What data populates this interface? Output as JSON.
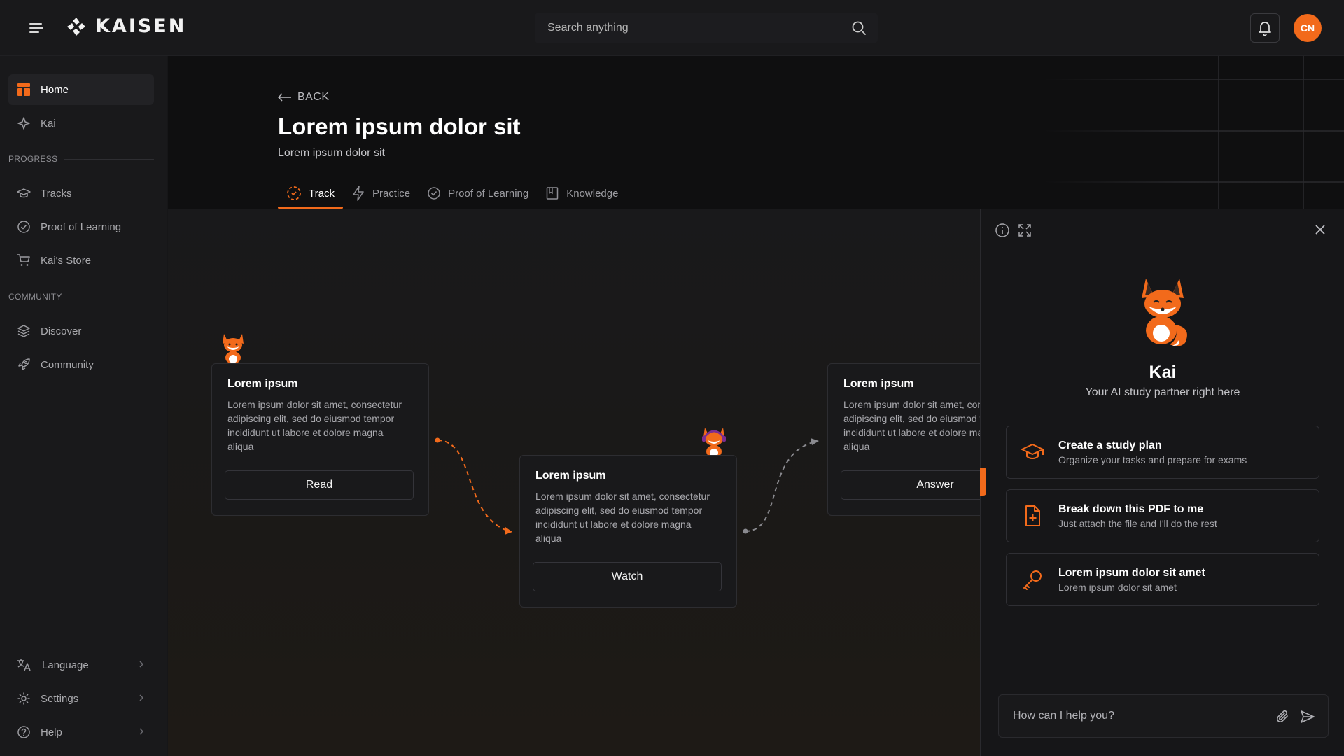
{
  "header": {
    "brand": "KAISEN",
    "search_placeholder": "Search anything",
    "avatar_initials": "CN"
  },
  "sidebar": {
    "top_items": [
      {
        "label": "Home",
        "icon": "home-icon",
        "active": true
      },
      {
        "label": "Kai",
        "icon": "sparkle-icon"
      }
    ],
    "progress_label": "PROGRESS",
    "progress_items": [
      {
        "label": "Tracks",
        "icon": "graduation-icon"
      },
      {
        "label": "Proof of Learning",
        "icon": "check-circle-icon"
      },
      {
        "label": "Kai's Store",
        "icon": "cart-icon"
      }
    ],
    "community_label": "COMMUNITY",
    "community_items": [
      {
        "label": "Discover",
        "icon": "layers-icon"
      },
      {
        "label": "Community",
        "icon": "rocket-icon"
      }
    ],
    "bottom_items": [
      {
        "label": "Language",
        "icon": "translate-icon"
      },
      {
        "label": "Settings",
        "icon": "gear-icon"
      },
      {
        "label": "Help",
        "icon": "help-icon"
      }
    ]
  },
  "page": {
    "back_label": "BACK",
    "title": "Lorem ipsum dolor sit",
    "subtitle": "Lorem ipsum dolor sit",
    "tabs": [
      {
        "label": "Track",
        "icon": "track-icon",
        "active": true
      },
      {
        "label": "Practice",
        "icon": "bolt-icon"
      },
      {
        "label": "Proof of Learning",
        "icon": "check-circle-icon"
      },
      {
        "label": "Knowledge",
        "icon": "book-icon"
      }
    ]
  },
  "track": {
    "cards": [
      {
        "title": "Lorem ipsum",
        "body": "Lorem ipsum dolor sit amet, consectetur adipiscing elit, sed do eiusmod tempor incididunt ut labore et dolore magna aliqua",
        "button": "Read"
      },
      {
        "title": "Lorem ipsum",
        "body": "Lorem ipsum dolor sit amet, consectetur adipiscing elit, sed do eiusmod tempor incididunt ut labore et dolore magna aliqua",
        "button": "Watch"
      },
      {
        "title": "Lorem ipsum",
        "body": "Lorem ipsum dolor sit amet, consectetur adipiscing elit, sed do eiusmod tempor incididunt ut labore et dolore magna aliqua",
        "button": "Answer"
      }
    ]
  },
  "kai_panel": {
    "name": "Kai",
    "tagline": "Your AI study partner right here",
    "suggestions": [
      {
        "title": "Create a study plan",
        "desc": "Organize your tasks and prepare for exams",
        "icon": "graduation-cap-icon"
      },
      {
        "title": "Break down this PDF to me",
        "desc": "Just attach the file and I'll do the rest",
        "icon": "file-plus-icon"
      },
      {
        "title": "Lorem ipsum dolor sit amet",
        "desc": "Lorem ipsum dolor sit amet",
        "icon": "key-icon"
      }
    ],
    "chat_placeholder": "How can I help you?"
  },
  "colors": {
    "accent": "#f26a1b",
    "background": "#161618"
  }
}
